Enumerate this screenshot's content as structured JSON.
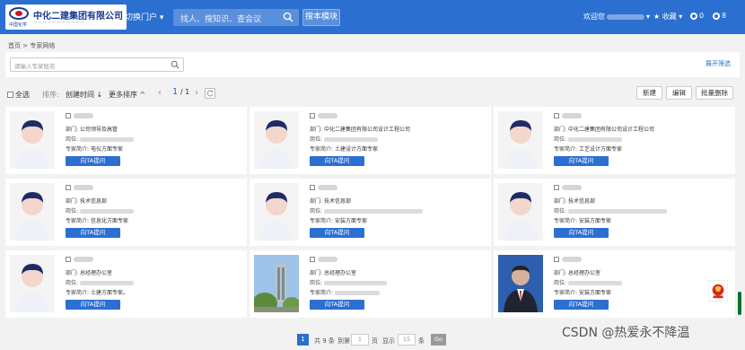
{
  "header": {
    "logo_text": "中化二建集团有限公司",
    "logo_sub": "中国化学",
    "portal_label": "切换门户",
    "search_placeholder": "找人、搜知识、查会议",
    "search_button": "搜本模块",
    "welcome": "欢迎您",
    "favorites": "收藏",
    "count_a": "0",
    "count_b": "8"
  },
  "breadcrumb": {
    "home": "首页",
    "sep": ">",
    "current": "专家网络"
  },
  "filter": {
    "placeholder": "请输入专家姓名",
    "expand": "展开筛选"
  },
  "toolbar": {
    "select_all": "全选",
    "sort_label": "排序:",
    "sort_created": "创建时间",
    "sort_more": "更多排序",
    "page_current": "1",
    "page_total": "/ 1",
    "btn_new": "新建",
    "btn_edit": "编辑",
    "btn_batch_delete": "批量删除"
  },
  "labels": {
    "dept": "部门:",
    "post": "岗位:",
    "intro": "专家简介:",
    "ask": "向TA提问"
  },
  "experts": [
    {
      "dept": "公司领导及高管",
      "intro": "电仪方面专家"
    },
    {
      "dept": "中化二建集团有限公司设计工程公司",
      "intro": "土建设计方面专家"
    },
    {
      "dept": "中化二建集团有限公司设计工程公司",
      "intro": "工艺设计方面专家"
    },
    {
      "dept": "技术信息部",
      "intro": "信息化方面专家"
    },
    {
      "dept": "技术信息部",
      "intro": "安装方面专家"
    },
    {
      "dept": "技术信息部",
      "intro": "安装方面专家"
    },
    {
      "dept": "总经理办公室",
      "intro": "土建方面专家。"
    },
    {
      "dept": "总经理办公室",
      "intro": ""
    },
    {
      "dept": "总经理办公室",
      "intro": "安装方面专家"
    }
  ],
  "pagination": {
    "current": "1",
    "total_text": "共 9 条",
    "goto_label": "到第",
    "goto_value": "1",
    "page_unit": "页",
    "show_label": "显示",
    "size_value": "15",
    "size_unit": "条",
    "go": "Go"
  },
  "watermark": "CSDN @热爱永不降温"
}
